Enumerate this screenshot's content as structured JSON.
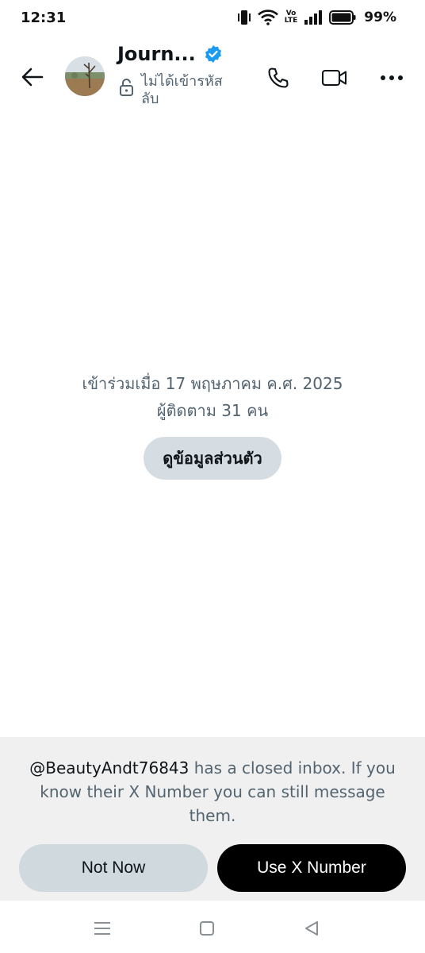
{
  "status_bar": {
    "time": "12:31",
    "battery_percent": "99%",
    "volte_top": "Vo",
    "volte_bottom": "LTE",
    "icons": [
      "vibrate-icon",
      "wifi-icon",
      "volte-icon",
      "signal-icon",
      "battery-icon"
    ]
  },
  "header": {
    "title": "Journ...",
    "verified": true,
    "encryption_status": "ไม่ได้เข้ารหัสลับ",
    "icons": [
      "back-arrow-icon",
      "phone-icon",
      "video-camera-icon",
      "more-icon",
      "unlock-icon",
      "verified-badge-icon"
    ]
  },
  "profile": {
    "joined": "เข้าร่วมเมื่อ 17 พฤษภาคม ค.ศ. 2025",
    "followers": "ผู้ติดตาม 31 คน",
    "view_profile_label": "ดูข้อมูลส่วนตัว"
  },
  "inbox_notice": {
    "handle": "@BeautyAndt76843",
    "message": " has a closed inbox. If you know their X Number you can still message them.",
    "not_now_label": "Not Now",
    "use_number_label": "Use X Number"
  },
  "colors": {
    "accent_verified": "#1d9bf0",
    "secondary_text": "#536471",
    "primary_button": "#000000",
    "secondary_button": "#cfd9de",
    "panel_bg": "#f0f0f0"
  },
  "nav_bar": {
    "icons": [
      "recent-apps-icon",
      "home-icon",
      "back-icon"
    ]
  }
}
